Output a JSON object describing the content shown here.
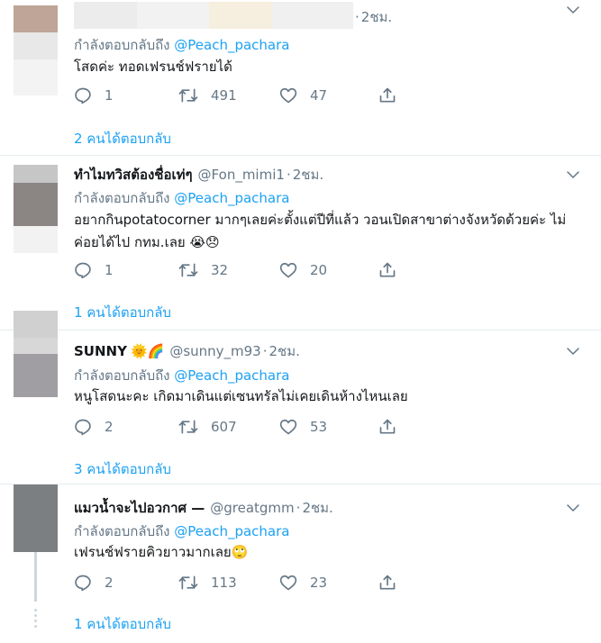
{
  "tweets": [
    {
      "name": "",
      "name_hidden": true,
      "handle": "",
      "time": "2ชม.",
      "replying_prefix": "กำลังตอบกลับถึง",
      "replying_to": "@Peach_pachara",
      "text": "โสดค่ะ ทอดเฟรนช์ฟรายได้",
      "replies": "1",
      "retweets": "491",
      "likes": "47",
      "show_replies": "2 คนได้ตอบกลับ"
    },
    {
      "name": "ทำไมทวิสต้องชื่อเท่ๆ",
      "handle": "@Fon_mimi1",
      "time": "2ชม.",
      "replying_prefix": "กำลังตอบกลับถึง",
      "replying_to": "@Peach_pachara",
      "text": "อยากกินpotatocorner มากๆเลยค่ะตั้งแต่ปีที่แล้ว วอนเปิดสาขาต่างจังหวัดด้วยค่ะ ไม่ค่อยได้ไป กทม.เลย 😭😞",
      "replies": "1",
      "retweets": "32",
      "likes": "20",
      "show_replies": "1 คนได้ตอบกลับ"
    },
    {
      "name": "SUNNY",
      "name_emoji": "🌞🌈",
      "handle": "@sunny_m93",
      "time": "2ชม.",
      "replying_prefix": "กำลังตอบกลับถึง",
      "replying_to": "@Peach_pachara",
      "text": "หนูโสดนะคะ เกิดมาเดินแต่เซนทรัลไม่เคยเดินห้างไหนเลย",
      "replies": "2",
      "retweets": "607",
      "likes": "53",
      "show_replies": "3 คนได้ตอบกลับ"
    },
    {
      "name": "แมวน้ำจะไปอวกาศ —",
      "handle": "@greatgmm",
      "time": "2ชม.",
      "replying_prefix": "กำลังตอบกลับถึง",
      "replying_to": "@Peach_pachara",
      "text": "เฟรนช์ฟรายคิวยาวมากเลย🙄",
      "replies": "2",
      "retweets": "113",
      "likes": "23",
      "show_replies": "1 คนได้ตอบกลับ"
    }
  ],
  "icons": {
    "reply": "reply-icon",
    "retweet": "retweet-icon",
    "like": "like-icon",
    "share": "share-icon",
    "caret": "chevron-down-icon"
  },
  "colors": {
    "link": "#1da1f2",
    "muted": "#657786",
    "text": "#14171a",
    "divider": "#e6ecf0",
    "thread": "#ccd6dd"
  }
}
